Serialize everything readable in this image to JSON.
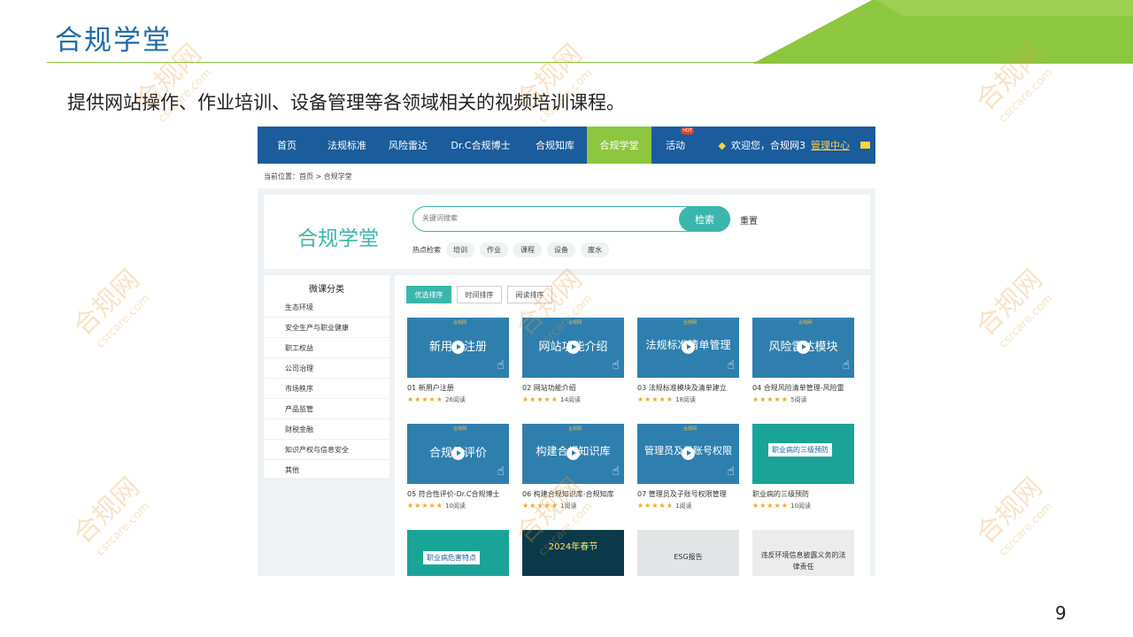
{
  "slide": {
    "title": "合规学堂",
    "subtitle": "提供网站操作、作业培训、设备管理等各领域相关的视频培训课程。",
    "page_number": "9",
    "watermark": "合规网",
    "watermark_url": "csrcare.com",
    "colors": {
      "title": "#1f6aa6",
      "accent_green": "#8dc63f",
      "site_nav": "#1a5c9c",
      "teal": "#3bb6ad"
    }
  },
  "site": {
    "nav": {
      "items": [
        {
          "label": "首页"
        },
        {
          "label": "法规标准"
        },
        {
          "label": "风险雷达"
        },
        {
          "label": "Dr.C合规博士"
        },
        {
          "label": "合规知库"
        },
        {
          "label": "合规学堂",
          "active": true
        },
        {
          "label": "活动",
          "badge": "HOT"
        }
      ],
      "welcome": "欢迎您，合规网3",
      "admin_link": "管理中心"
    },
    "breadcrumb": "当前位置：首页 > 合规学堂",
    "brand": "合规学堂",
    "search": {
      "placeholder": "关键词搜索",
      "button": "检索",
      "reset": "重置",
      "hot_label": "热点检索",
      "hot_tags": [
        "培训",
        "作业",
        "课程",
        "设备",
        "废水"
      ]
    },
    "sidebar": {
      "title": "微课分类",
      "categories": [
        "生态环境",
        "安全生产与职业健康",
        "职工权益",
        "公司治理",
        "市场秩序",
        "产品监管",
        "财税金融",
        "知识产权与信息安全",
        "其他"
      ]
    },
    "sort": [
      "优选排序",
      "时间排序",
      "阅读排序"
    ],
    "courses": [
      {
        "thumb_text": "新用户注册",
        "title": "01 新用户注册",
        "reads": "26阅读",
        "stars": "★★★★★"
      },
      {
        "thumb_text": "网站功能介绍",
        "title": "02 网站功能介绍",
        "reads": "14阅读",
        "stars": "★★★★★"
      },
      {
        "thumb_text": "法规标准清单管理",
        "title": "03 法规标准模块及清单建立",
        "reads": "18阅读",
        "stars": "★★★★★"
      },
      {
        "thumb_text": "风险雷达模块",
        "title": "04 合规风险清单管理-风险雷",
        "reads": "5阅读",
        "stars": "★★★★★"
      },
      {
        "thumb_text": "合规性评价",
        "title": "05 符合性评价-Dr.C合规博士",
        "reads": "10阅读",
        "stars": "★★★★★"
      },
      {
        "thumb_text": "构建合规知识库",
        "title": "06 构建合规知识库-合规知库",
        "reads": "1阅读",
        "stars": "★★★★★"
      },
      {
        "thumb_text": "管理员及子账号权限",
        "title": "07 管理员及子账号权限管理",
        "reads": "1阅读",
        "stars": "★★★★★"
      },
      {
        "thumb_text": "职业病的三级预防",
        "title": "职业病的三级预防",
        "reads": "10阅读",
        "stars": "★★★★★"
      },
      {
        "thumb_text": "职业病危害特点"
      },
      {
        "thumb_text": "2024年春节"
      },
      {
        "thumb_text": "ESG报告"
      },
      {
        "thumb_text": "违反环境信息披露义务的法律责任"
      }
    ]
  }
}
